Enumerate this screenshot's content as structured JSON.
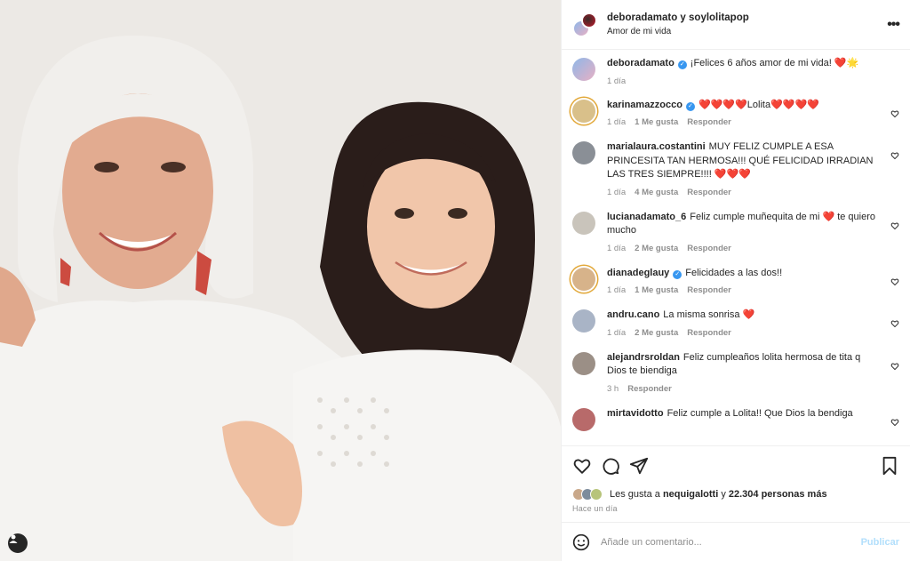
{
  "header": {
    "title": "deboradamato y soylolitapop",
    "subtitle": "Amor de mi vida",
    "more_label": "•••"
  },
  "caption": {
    "user": "deboradamato",
    "text": "¡Felices 6 años amor de mi vida! ❤️🌟",
    "time": "1 día"
  },
  "comments": [
    {
      "user": "karinamazzocco",
      "verified": true,
      "text": "❤️❤️❤️❤️Lolita❤️❤️❤️❤️",
      "time": "1 día",
      "likes": "1 Me gusta",
      "reply": "Responder",
      "avatar": "#d9c08a",
      "ring": true
    },
    {
      "user": "marialaura.costantini",
      "verified": false,
      "text": "MUY FELIZ CUMPLE A ESA PRINCESITA TAN HERMOSA!!! QUÉ FELICIDAD IRRADIAN LAS TRES SIEMPRE!!!! ❤️❤️❤️",
      "time": "1 día",
      "likes": "4 Me gusta",
      "reply": "Responder",
      "avatar": "#8a8f96",
      "ring": false
    },
    {
      "user": "lucianadamato_6",
      "verified": false,
      "text": "Feliz cumple muñequita de mi ❤️ te quiero mucho",
      "time": "1 día",
      "likes": "2 Me gusta",
      "reply": "Responder",
      "avatar": "#c9c4bb",
      "ring": false
    },
    {
      "user": "dianadeglauy",
      "verified": true,
      "text": "Felicidades a las dos!!",
      "time": "1 día",
      "likes": "1 Me gusta",
      "reply": "Responder",
      "avatar": "#d7b38a",
      "ring": true
    },
    {
      "user": "andru.cano",
      "verified": false,
      "text": "La misma sonrisa ❤️",
      "time": "1 día",
      "likes": "2 Me gusta",
      "reply": "Responder",
      "avatar": "#a9b4c6",
      "ring": false
    },
    {
      "user": "alejandrsroldan",
      "verified": false,
      "text": "Feliz cumpleaños lolita hermosa de tita q Dios te biendiga",
      "time": "3 h",
      "likes": "",
      "reply": "Responder",
      "avatar": "#9b8f86",
      "ring": false
    },
    {
      "user": "mirtavidotto",
      "verified": false,
      "text": "Feliz cumple a Lolita!! Que Dios la bendiga",
      "time": "",
      "likes": "",
      "reply": "",
      "avatar": "#b86a6a",
      "ring": false
    }
  ],
  "likes": {
    "prefix": "Les gusta a",
    "user": "nequigalotti",
    "connector": "y",
    "count": "22.304 personas más"
  },
  "time_ago": "Hace un día",
  "composer": {
    "placeholder": "Añade un comentario...",
    "post_label": "Publicar"
  },
  "icons": {
    "like": "heart-icon",
    "comment": "comment-icon",
    "share": "share-icon",
    "save": "bookmark-icon",
    "emoji": "emoji-icon",
    "tag": "user-tag-icon"
  },
  "colors": {
    "verified": "#3897f0",
    "post_disabled": "#b2dffc",
    "secondary_text": "#8e8e8e"
  }
}
